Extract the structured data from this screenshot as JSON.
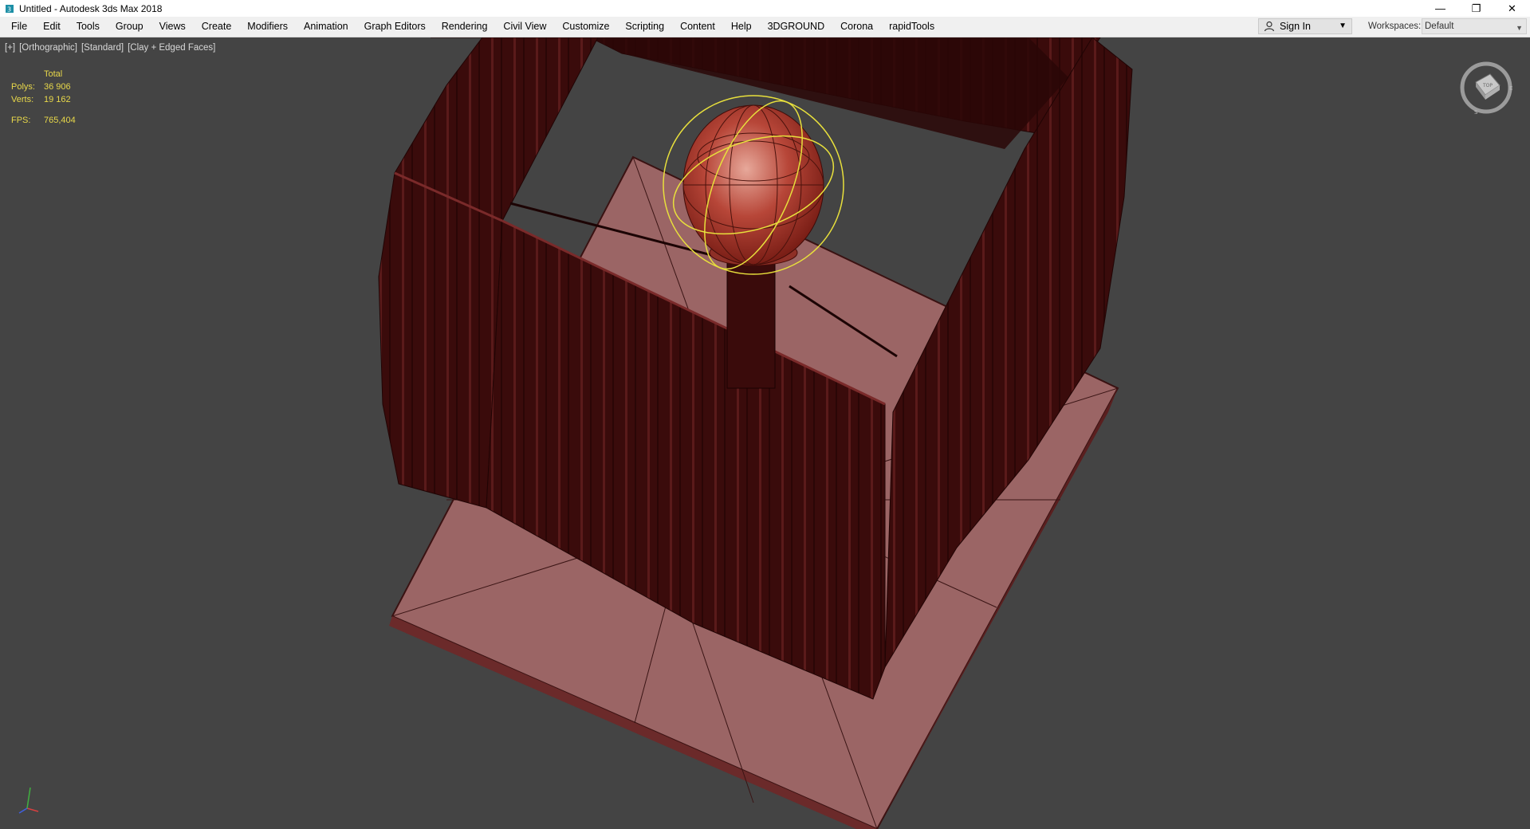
{
  "window": {
    "title": "Untitled - Autodesk 3ds Max 2018",
    "minimize": "—",
    "restore": "❐",
    "close": "✕"
  },
  "menu": {
    "items": [
      {
        "label": "File"
      },
      {
        "label": "Edit"
      },
      {
        "label": "Tools"
      },
      {
        "label": "Group"
      },
      {
        "label": "Views"
      },
      {
        "label": "Create"
      },
      {
        "label": "Modifiers"
      },
      {
        "label": "Animation"
      },
      {
        "label": "Graph Editors"
      },
      {
        "label": "Rendering"
      },
      {
        "label": "Civil View"
      },
      {
        "label": "Customize"
      },
      {
        "label": "Scripting"
      },
      {
        "label": "Content"
      },
      {
        "label": "Help"
      },
      {
        "label": "3DGROUND"
      },
      {
        "label": "Corona"
      },
      {
        "label": "rapidTools"
      }
    ],
    "sign_in": "Sign In",
    "workspaces_label": "Workspaces:",
    "workspace_value": "Default"
  },
  "viewport": {
    "label_plus": "[+]",
    "label_view": "[Orthographic]",
    "label_shading_std": "[Standard]",
    "label_shading": "[Clay + Edged Faces]",
    "stats": {
      "total_label": "Total",
      "polys_label": "Polys:",
      "polys_value": "36 906",
      "verts_label": "Verts:",
      "verts_value": "19 162",
      "fps_label": "FPS:",
      "fps_value": "765,404"
    },
    "viewcube_face": "TOP",
    "colors": {
      "background": "#444444",
      "base_plate": "#9a6363",
      "curtain": "#3a0c0c",
      "knob": "#b24436",
      "gizmo": "#e8e03c",
      "stats_text": "#e8d84a"
    }
  }
}
